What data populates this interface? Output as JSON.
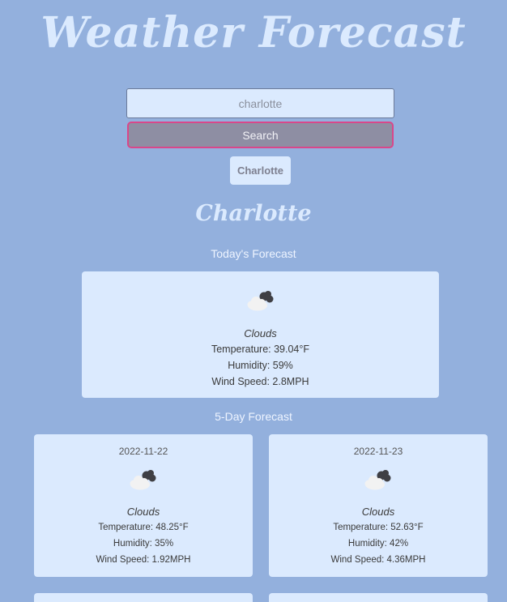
{
  "header": {
    "title": "Weather Forecast"
  },
  "search": {
    "placeholder": "charlotte",
    "value": "",
    "button_label": "Search"
  },
  "history": [
    "Charlotte"
  ],
  "city": "Charlotte",
  "today": {
    "heading": "Today's Forecast",
    "icon": "clouds-icon",
    "description": "Clouds",
    "temperature": "Temperature: 39.04°F",
    "humidity": "Humidity: 59%",
    "wind": "Wind Speed: 2.8MPH"
  },
  "forecast": {
    "heading": "5-Day Forecast",
    "days": [
      {
        "date": "2022-11-22",
        "icon": "clouds-icon",
        "description": "Clouds",
        "temperature": "Temperature: 48.25°F",
        "humidity": "Humidity: 35%",
        "wind": "Wind Speed: 1.92MPH"
      },
      {
        "date": "2022-11-23",
        "icon": "clouds-icon",
        "description": "Clouds",
        "temperature": "Temperature: 52.63°F",
        "humidity": "Humidity: 42%",
        "wind": "Wind Speed: 4.36MPH"
      },
      {
        "date": "",
        "icon": "",
        "description": "",
        "temperature": "",
        "humidity": "",
        "wind": ""
      },
      {
        "date": "",
        "icon": "",
        "description": "",
        "temperature": "",
        "humidity": "",
        "wind": ""
      }
    ]
  },
  "colors": {
    "background": "#93b0dd",
    "card": "#dbeafe",
    "search_button": "#8e8ea3",
    "search_button_border": "#d9478a"
  }
}
